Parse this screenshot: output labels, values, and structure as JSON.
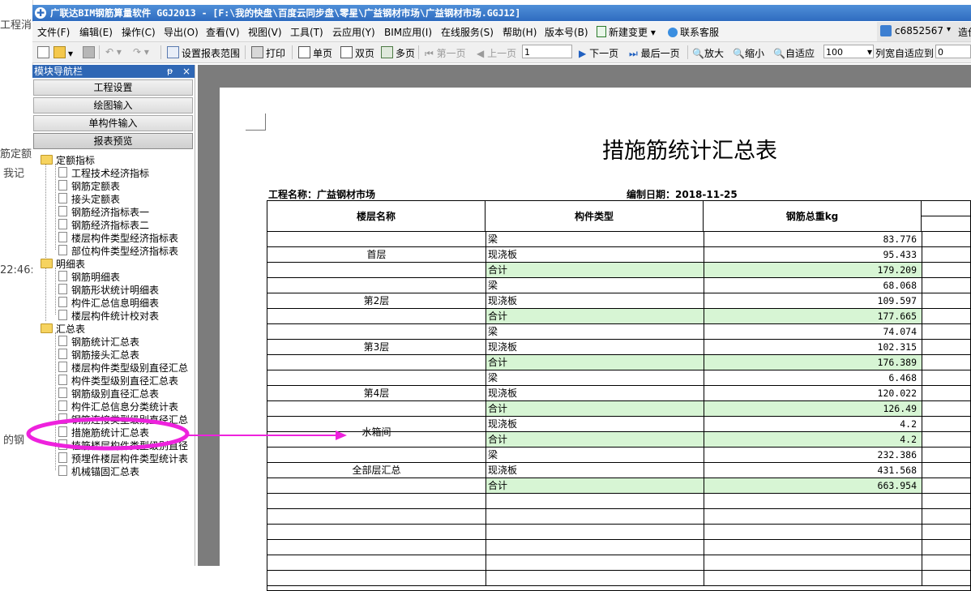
{
  "background_app": {
    "fragments": [
      "工程消",
      "筋定额",
      "我记",
      "22:46:",
      "的钢"
    ]
  },
  "window": {
    "title": "广联达BIM钢筋算量软件 GGJ2013 - [F:\\我的快盘\\百度云同步盘\\零星\\广益钢材市场\\广益钢材市场.GGJ12]"
  },
  "menu": {
    "items": [
      "文件(F)",
      "编辑(E)",
      "操作(C)",
      "导出(O)",
      "查看(V)",
      "视图(V)",
      "工具(T)",
      "云应用(Y)",
      "BIM应用(I)",
      "在线服务(S)",
      "帮助(H)",
      "版本号(B)",
      "新建变更",
      "联系客服"
    ],
    "user": "c6852567",
    "extra": "造价i"
  },
  "toolbar": {
    "report_range": "设置报表范围",
    "print": "打印",
    "single_page": "单页",
    "double_page": "双页",
    "multi_page": "多页",
    "first_page": "第一页",
    "prev_page": "上一页",
    "page_value": "1",
    "next_page": "下一页",
    "last_page": "最后一页",
    "zoom_in": "放大",
    "zoom_out": "缩小",
    "fit": "自适应",
    "zoom_value": "100",
    "col_fit": "列宽自适应到",
    "col_value": "0"
  },
  "nav": {
    "title": "模块导航栏",
    "pin": "ᵽ",
    "close": "×",
    "buttons": [
      "工程设置",
      "绘图输入",
      "单构件输入",
      "报表预览"
    ],
    "groups": [
      {
        "label": "定额指标",
        "items": [
          "工程技术经济指标",
          "钢筋定额表",
          "接头定额表",
          "钢筋经济指标表一",
          "钢筋经济指标表二",
          "楼层构件类型经济指标表",
          "部位构件类型经济指标表"
        ]
      },
      {
        "label": "明细表",
        "items": [
          "钢筋明细表",
          "钢筋形状统计明细表",
          "构件汇总信息明细表",
          "楼层构件统计校对表"
        ]
      },
      {
        "label": "汇总表",
        "items": [
          "钢筋统计汇总表",
          "钢筋接头汇总表",
          "楼层构件类型级别直径汇总",
          "构件类型级别直径汇总表",
          "钢筋级别直径汇总表",
          "构件汇总信息分类统计表",
          "钢筋连接类型级别直径汇总",
          "措施筋统计汇总表",
          "植筋楼层构件类型级别直径",
          "预埋件楼层构件类型统计表",
          "机械锚固汇总表"
        ]
      }
    ]
  },
  "report": {
    "title": "措施筋统计汇总表",
    "project": "工程名称：广益钢材市场",
    "date": "编制日期：2018-11-25",
    "headers": [
      "楼层名称",
      "构件类型",
      "钢筋总重kg"
    ],
    "groups": [
      {
        "floor": "首层",
        "rows": [
          [
            "梁",
            "83.776"
          ],
          [
            "现浇板",
            "95.433"
          ],
          [
            "合计",
            "179.209"
          ]
        ]
      },
      {
        "floor": "第2层",
        "rows": [
          [
            "梁",
            "68.068"
          ],
          [
            "现浇板",
            "109.597"
          ],
          [
            "合计",
            "177.665"
          ]
        ]
      },
      {
        "floor": "第3层",
        "rows": [
          [
            "梁",
            "74.074"
          ],
          [
            "现浇板",
            "102.315"
          ],
          [
            "合计",
            "176.389"
          ]
        ]
      },
      {
        "floor": "第4层",
        "rows": [
          [
            "梁",
            "6.468"
          ],
          [
            "现浇板",
            "120.022"
          ],
          [
            "合计",
            "126.49"
          ]
        ]
      },
      {
        "floor": "水箱间",
        "rows": [
          [
            "现浇板",
            "4.2"
          ],
          [
            "合计",
            "4.2"
          ]
        ]
      },
      {
        "floor": "全部层汇总",
        "rows": [
          [
            "梁",
            "232.386"
          ],
          [
            "现浇板",
            "431.568"
          ],
          [
            "合计",
            "663.954"
          ]
        ]
      }
    ]
  },
  "annotation": {
    "color": "#ee22dd"
  }
}
